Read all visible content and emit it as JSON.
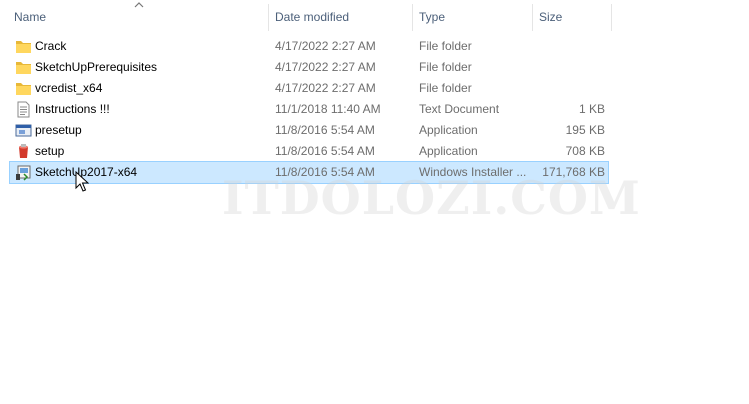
{
  "columns": {
    "name": "Name",
    "date_modified": "Date modified",
    "type": "Type",
    "size": "Size"
  },
  "files": [
    {
      "name": "Crack",
      "date": "4/17/2022 2:27 AM",
      "type": "File folder",
      "size": "",
      "icon": "folder-icon"
    },
    {
      "name": "SketchUpPrerequisites",
      "date": "4/17/2022 2:27 AM",
      "type": "File folder",
      "size": "",
      "icon": "folder-icon"
    },
    {
      "name": "vcredist_x64",
      "date": "4/17/2022 2:27 AM",
      "type": "File folder",
      "size": "",
      "icon": "folder-icon"
    },
    {
      "name": "Instructions !!!",
      "date": "11/1/2018 11:40 AM",
      "type": "Text Document",
      "size": "1 KB",
      "icon": "text-document-icon"
    },
    {
      "name": "presetup",
      "date": "11/8/2016 5:54 AM",
      "type": "Application",
      "size": "195 KB",
      "icon": "application-icon"
    },
    {
      "name": "setup",
      "date": "11/8/2016 5:54 AM",
      "type": "Application",
      "size": "708 KB",
      "icon": "setup-icon"
    },
    {
      "name": "SketchUp2017-x64",
      "date": "11/8/2016 5:54 AM",
      "type": "Windows Installer ...",
      "size": "171,768 KB",
      "icon": "installer-icon",
      "selected": true
    }
  ],
  "watermark": "ITDOLOZI.COM",
  "colors": {
    "selection": "#cce8ff",
    "selection_border": "#99d1ff",
    "header_text": "#4c607a",
    "folder": "#ffd75e"
  }
}
